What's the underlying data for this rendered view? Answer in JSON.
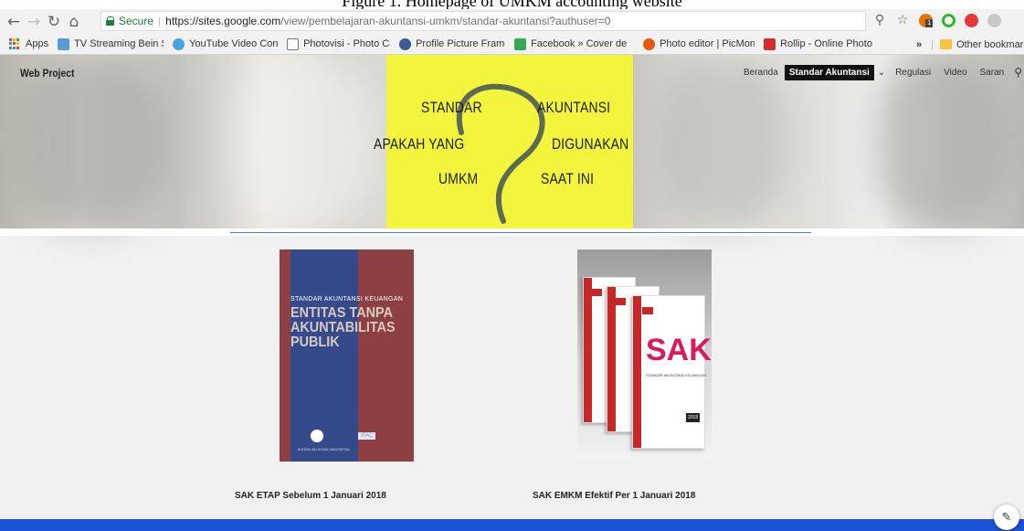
{
  "caption": "Figure 1. Homepage of UMKM accounting website",
  "browser": {
    "security_label": "Secure",
    "url_host": "https://sites.google.com",
    "url_path": "/view/pembelajaran-akuntansi-umkm/standar-akuntansi?authuser=0",
    "extension_badge": "1"
  },
  "bookmarks": [
    {
      "label": "Apps",
      "icon": "apps-grid-icon"
    },
    {
      "label": "TV Streaming Bein Sp",
      "icon": "page-icon",
      "color": "#5b9bd5"
    },
    {
      "label": "YouTube Video Conv",
      "icon": "convert-icon",
      "color": "#4aa3df"
    },
    {
      "label": "Photovisi - Photo Col",
      "icon": "doc-icon",
      "color": "#ffffff"
    },
    {
      "label": "Profile Picture Frame",
      "icon": "frame-icon",
      "color": "#3b5998"
    },
    {
      "label": "Facebook » Cover de",
      "icon": "cover-icon",
      "color": "#35a853"
    },
    {
      "label": "Photo editor | PicMon",
      "icon": "picmonkey-icon",
      "color": "#e8590c"
    },
    {
      "label": "Rollip - Online Photo",
      "icon": "rollip-icon",
      "color": "#d32f2f"
    }
  ],
  "bookmarks_overflow": "»",
  "other_bookmarks": "Other bookmarks",
  "site": {
    "title": "Web Project",
    "nav": [
      {
        "label": "Beranda",
        "active": false
      },
      {
        "label": "Standar Akuntansi",
        "active": true
      },
      {
        "label": "Regulasi",
        "active": false
      },
      {
        "label": "Video",
        "active": false
      },
      {
        "label": "Saran",
        "active": false
      }
    ]
  },
  "hero": {
    "line1_left": "STANDAR",
    "line1_right": "AKUNTANSI",
    "line2_left": "APAKAH YANG",
    "line2_right": "DIGUNAKAN",
    "line3_left": "UMKM",
    "line3_right": "SAAT INI"
  },
  "book1": {
    "subtitle": "STANDAR AKUNTANSI KEUANGAN",
    "title_lines": [
      "ENTITAS TANPA",
      "AKUNTABILITAS",
      "PUBLIK"
    ],
    "publisher": "IKATAN AKUNTAN INDONESIA",
    "partner": "IFAC"
  },
  "book2": {
    "brand": "SAK",
    "subtitle": "STANDAR AKUNTANSI KEUANGAN",
    "year": "2018"
  },
  "captions": {
    "left": "SAK ETAP Sebelum 1 Januari 2018",
    "right": "SAK EMKM Efektif Per 1 Januari 2018"
  },
  "colors": {
    "accent_blue": "#1a53d6",
    "sticky_note": "#f2f53b",
    "secure_green": "#188038"
  }
}
